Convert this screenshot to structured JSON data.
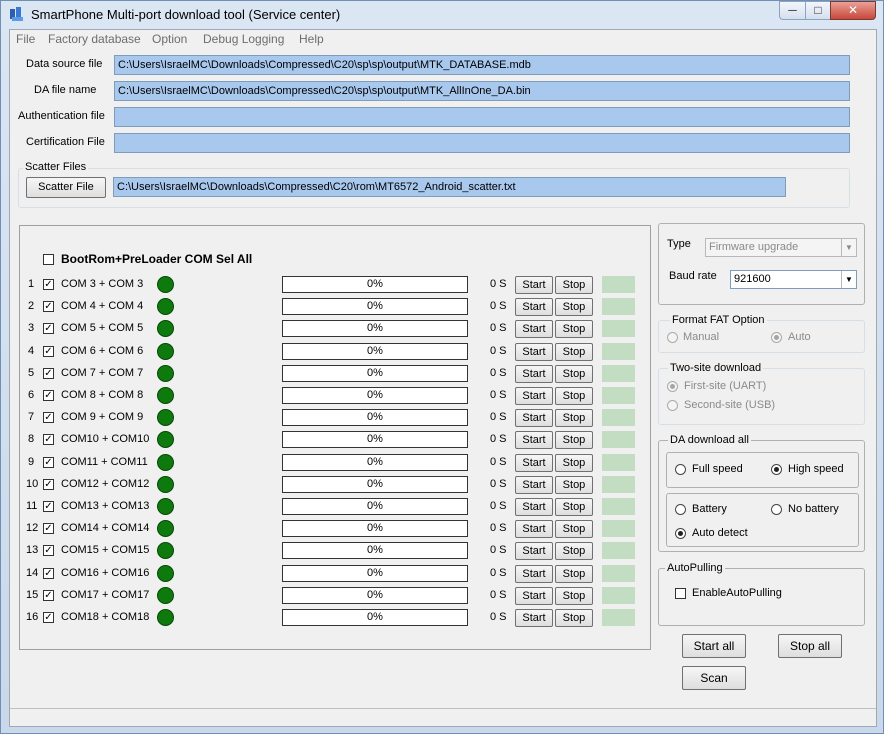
{
  "window": {
    "title": "SmartPhone Multi-port download tool (Service center)",
    "min_label": "─",
    "max_label": "□",
    "close_label": "✕"
  },
  "menu": [
    "File",
    "Factory database",
    "Option",
    "Debug Logging",
    "Help"
  ],
  "files": {
    "data_source_label": "Data source file",
    "data_source_value": "C:\\Users\\IsraelMC\\Downloads\\Compressed\\C20\\sp\\sp\\output\\MTK_DATABASE.mdb",
    "da_file_label": "DA file name",
    "da_file_value": "C:\\Users\\IsraelMC\\Downloads\\Compressed\\C20\\sp\\sp\\output\\MTK_AllInOne_DA.bin",
    "auth_label": "Authentication file",
    "auth_value": "",
    "cert_label": "Certification File",
    "cert_value": ""
  },
  "scatter": {
    "group_title": "Scatter Files",
    "button_label": "Scatter File",
    "value": "C:\\Users\\IsraelMC\\Downloads\\Compressed\\C20\\rom\\MT6572_Android_scatter.txt"
  },
  "ports": {
    "select_all_label": "BootRom+PreLoader COM Sel All",
    "start_label": "Start",
    "stop_label": "Stop",
    "rows": [
      {
        "index": "1",
        "com": "COM 3 + COM 3",
        "progress": "0%",
        "time": "0 S"
      },
      {
        "index": "2",
        "com": "COM 4 + COM 4",
        "progress": "0%",
        "time": "0 S"
      },
      {
        "index": "3",
        "com": "COM 5 + COM 5",
        "progress": "0%",
        "time": "0 S"
      },
      {
        "index": "4",
        "com": "COM 6 + COM 6",
        "progress": "0%",
        "time": "0 S"
      },
      {
        "index": "5",
        "com": "COM 7 + COM 7",
        "progress": "0%",
        "time": "0 S"
      },
      {
        "index": "6",
        "com": "COM 8 + COM 8",
        "progress": "0%",
        "time": "0 S"
      },
      {
        "index": "7",
        "com": "COM 9 + COM 9",
        "progress": "0%",
        "time": "0 S"
      },
      {
        "index": "8",
        "com": "COM10 + COM10",
        "progress": "0%",
        "time": "0 S"
      },
      {
        "index": "9",
        "com": "COM11 + COM11",
        "progress": "0%",
        "time": "0 S"
      },
      {
        "index": "10",
        "com": "COM12 + COM12",
        "progress": "0%",
        "time": "0 S"
      },
      {
        "index": "11",
        "com": "COM13 + COM13",
        "progress": "0%",
        "time": "0 S"
      },
      {
        "index": "12",
        "com": "COM14 + COM14",
        "progress": "0%",
        "time": "0 S"
      },
      {
        "index": "13",
        "com": "COM15 + COM15",
        "progress": "0%",
        "time": "0 S"
      },
      {
        "index": "14",
        "com": "COM16 + COM16",
        "progress": "0%",
        "time": "0 S"
      },
      {
        "index": "15",
        "com": "COM17 + COM17",
        "progress": "0%",
        "time": "0 S"
      },
      {
        "index": "16",
        "com": "COM18 + COM18",
        "progress": "0%",
        "time": "0 S"
      }
    ]
  },
  "settings": {
    "type_label": "Type",
    "type_value": "Firmware upgrade",
    "baud_label": "Baud rate",
    "baud_value": "921600",
    "format_fat_title": "Format FAT Option",
    "format_manual": "Manual",
    "format_auto": "Auto",
    "two_site_title": "Two-site download",
    "first_site": "First-site (UART)",
    "second_site": "Second-site (USB)",
    "da_all_title": "DA download all",
    "full_speed": "Full speed",
    "high_speed": "High speed",
    "battery": "Battery",
    "no_battery": "No battery",
    "auto_detect": "Auto detect",
    "autopulling_title": "AutoPulling",
    "enable_autopulling": "EnableAutoPulling"
  },
  "actions": {
    "start_all": "Start all",
    "stop_all": "Stop all",
    "scan": "Scan"
  },
  "colors": {
    "path_field": "#a9c8ee",
    "led_green": "#0e7a0e",
    "status_block": "#c3ddc3"
  }
}
